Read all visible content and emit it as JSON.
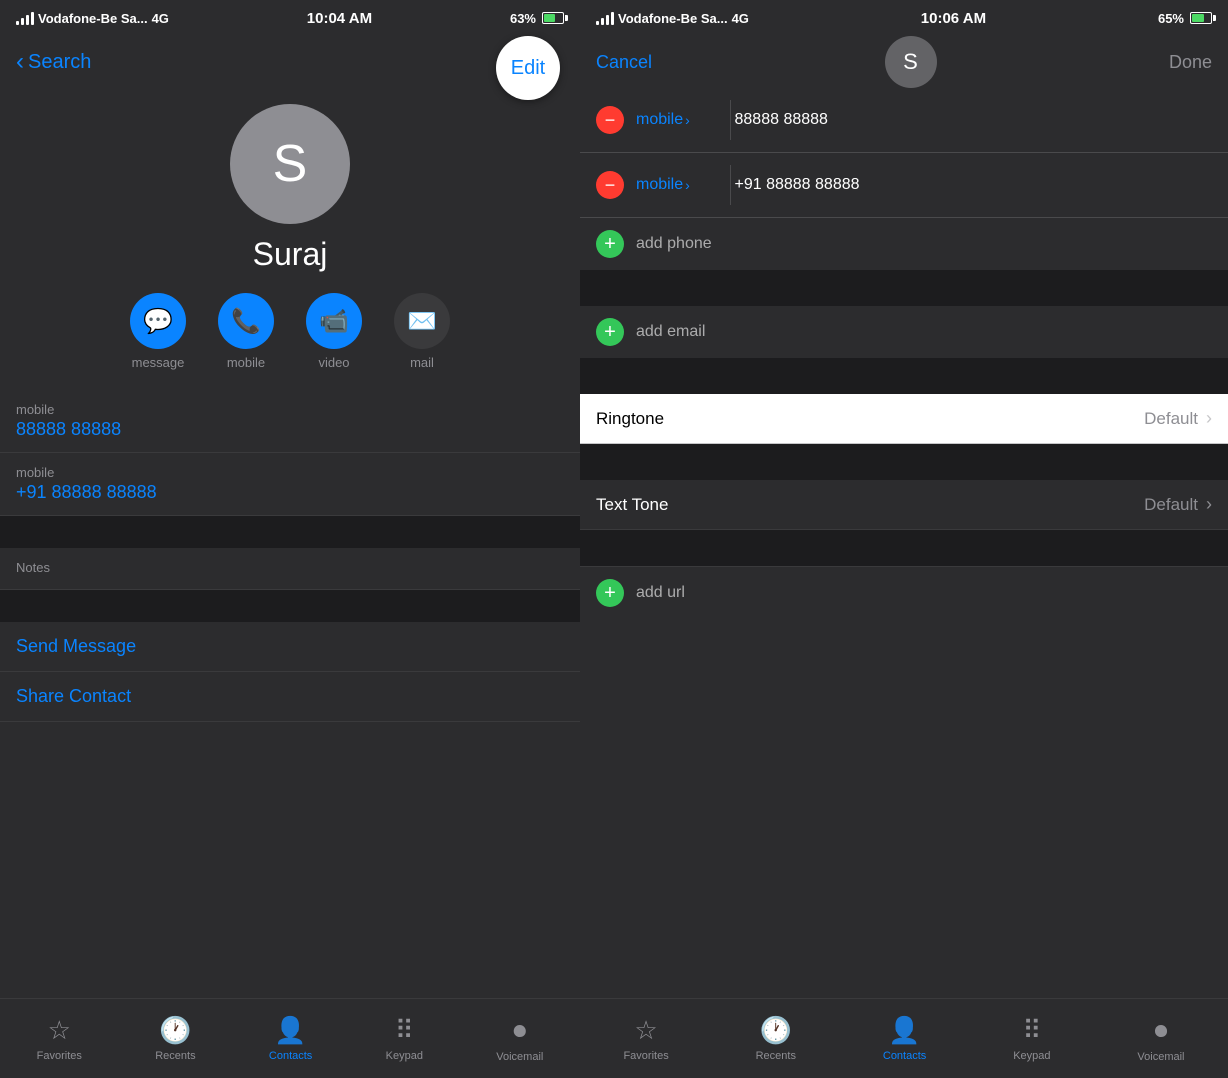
{
  "left": {
    "statusBar": {
      "carrier": "Vodafone-Be Sa...",
      "networkType": "4G",
      "time": "10:04 AM",
      "battery": "63%"
    },
    "nav": {
      "backLabel": "Search",
      "editLabel": "Edit"
    },
    "contact": {
      "initial": "S",
      "name": "Suraj"
    },
    "actions": [
      {
        "id": "message",
        "icon": "💬",
        "label": "message",
        "color": "blue"
      },
      {
        "id": "mobile",
        "icon": "📞",
        "label": "mobile",
        "color": "blue"
      },
      {
        "id": "video",
        "icon": "📹",
        "label": "video",
        "color": "blue"
      },
      {
        "id": "mail",
        "icon": "✉️",
        "label": "mail",
        "color": "gray"
      }
    ],
    "infoRows": [
      {
        "label": "mobile",
        "value": "88888 88888"
      },
      {
        "label": "mobile",
        "value": "+91 88888 88888"
      }
    ],
    "actionRows": [
      {
        "label": "Send Message"
      },
      {
        "label": "Share Contact"
      }
    ],
    "tabBar": [
      {
        "id": "favorites",
        "icon": "☆",
        "label": "Favorites",
        "active": false
      },
      {
        "id": "recents",
        "icon": "🕐",
        "label": "Recents",
        "active": false
      },
      {
        "id": "contacts",
        "icon": "👤",
        "label": "Contacts",
        "active": true
      },
      {
        "id": "keypad",
        "icon": "⠿",
        "label": "Keypad",
        "active": false
      },
      {
        "id": "voicemail",
        "icon": "⏺",
        "label": "Voicemail",
        "active": false
      }
    ]
  },
  "right": {
    "statusBar": {
      "carrier": "Vodafone-Be Sa...",
      "networkType": "4G",
      "time": "10:06 AM",
      "battery": "65%"
    },
    "nav": {
      "cancelLabel": "Cancel",
      "doneLabel": "Done",
      "contactInitial": "S"
    },
    "phoneRows": [
      {
        "label": "mobile",
        "value": "88888 88888",
        "removable": true
      },
      {
        "label": "mobile",
        "value": "+91 88888 88888",
        "removable": true
      }
    ],
    "addPhone": "add phone",
    "addEmail": "add email",
    "ringtone": {
      "label": "Ringtone",
      "value": "Default"
    },
    "textTone": {
      "label": "Text Tone",
      "value": "Default"
    },
    "addUrl": "add url",
    "tabBar": [
      {
        "id": "favorites",
        "icon": "☆",
        "label": "Favorites",
        "active": false
      },
      {
        "id": "recents",
        "icon": "🕐",
        "label": "Recents",
        "active": false
      },
      {
        "id": "contacts",
        "icon": "👤",
        "label": "Contacts",
        "active": true
      },
      {
        "id": "keypad",
        "icon": "⠿",
        "label": "Keypad",
        "active": false
      },
      {
        "id": "voicemail",
        "icon": "⏺",
        "label": "Voicemail",
        "active": false
      }
    ]
  }
}
